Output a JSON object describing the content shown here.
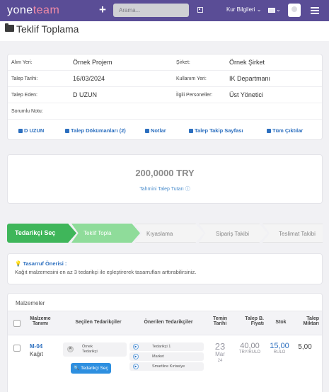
{
  "app": {
    "logo_part1": "yone",
    "logo_part2": "team",
    "search_placeholder": "Arama...",
    "kur_label": "Kur Bilgileri",
    "caret": "⌄",
    "colors": {
      "topbar": "#5a4d96",
      "link": "#2c6fbf",
      "active_step": "#3fb65a"
    }
  },
  "page": {
    "title": "Teklif Toplama"
  },
  "info": {
    "rows": [
      {
        "label": "Alım Yeri:",
        "value": "Örnek Projem",
        "label2": "Şirket:",
        "value2": "Örnek Şirket"
      },
      {
        "label": "Talep Tarihi:",
        "value": "16/03/2024",
        "label2": "Kullanım Yeri:",
        "value2": "IK Departmanı"
      },
      {
        "label": "Talep Eden:",
        "value": "D UZUN",
        "label2": "İlgili Personeller:",
        "value2": "Üst Yönetici"
      },
      {
        "label": "Sorumlu Notu:",
        "value": ""
      }
    ],
    "links": {
      "user": "D UZUN",
      "documents": "Talep Dökümanları (2)",
      "notes": "Notlar",
      "tracking": "Talep Takip Sayfası",
      "outputs": "Tüm Çıktılar"
    }
  },
  "amount": {
    "value": "200,0000 TRY",
    "label": "Tahmini Talep Tutarı ⓘ"
  },
  "steps": [
    "Tedarikçi Seç",
    "Teklif Topla",
    "Kıyaslama",
    "Sipariş Takibi",
    "Teslimat Takibi"
  ],
  "tip": {
    "title": "Tasarruf Önerisi :",
    "text": "Kağıt malzemesini en az 3 tedarikçi ile eşleştirerek tasarrufları arttırabilirsiniz."
  },
  "materials": {
    "title": "Malzemeler",
    "headers": {
      "name1": "Malzeme",
      "name2": "Tanımı",
      "selected": "Seçilen Tedarikçiler",
      "recommended": "Önerilen Tedarikçiler",
      "date1": "Temin",
      "date2": "Tarihi",
      "price1": "Talep B.",
      "price2": "Fiyatı",
      "stock": "Stok",
      "qty1": "Talep",
      "qty2": "Miktarı"
    },
    "rows": [
      {
        "code": "M-04",
        "name": "Kağıt",
        "selected_supplier_1": "Örnek",
        "selected_supplier_2": "Tedarikçi",
        "select_button": "Tedarikçi Seç",
        "recommended": [
          "Tedarikçi 1",
          "Market",
          "Smartline Kırtasiye"
        ],
        "date_day": "23",
        "date_month": "Mar",
        "date_year": "24",
        "price": "40,00",
        "price_unit": "TRY/RULO",
        "stock": "15,00",
        "stock_unit": "RULO",
        "qty": "5,00"
      }
    ]
  }
}
